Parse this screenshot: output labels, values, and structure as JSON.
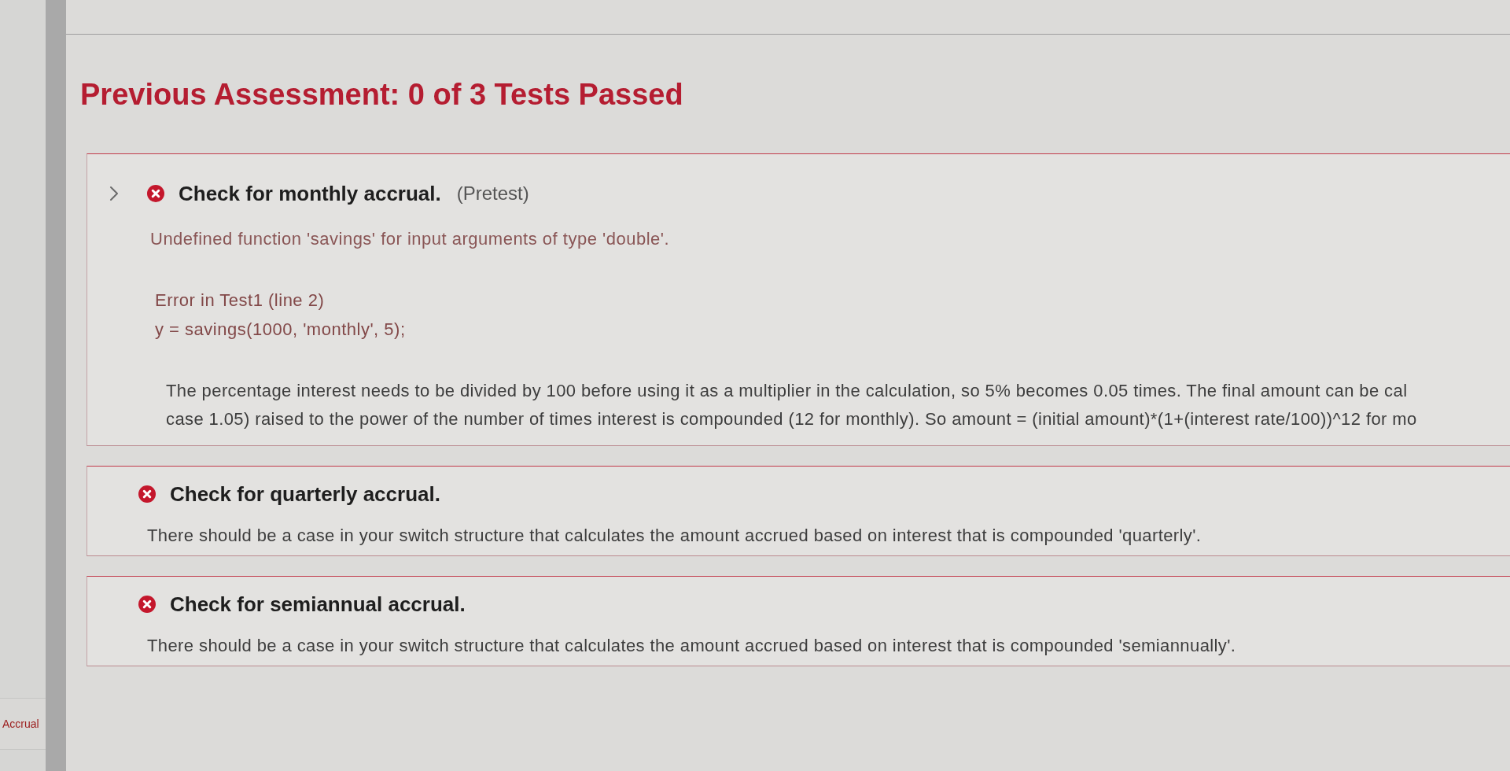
{
  "sidebar": {
    "items": [
      {
        "label": "Accrual",
        "selected": true
      }
    ]
  },
  "heading": "Previous Assessment: 0 of 3 Tests Passed",
  "tests": [
    {
      "title": "Check for monthly accrual.",
      "tag": "(Pretest)",
      "passed": false,
      "expandable": true,
      "error_message": "Undefined function 'savings' for input arguments of type 'double'.",
      "error_location": "Error in Test1 (line 2)",
      "error_code": "y = savings(1000, 'monthly', 5);",
      "feedback_lines": [
        "The percentage interest needs to be divided by 100 before using it as a multiplier in the calculation, so 5% becomes 0.05 times. The final amount can be cal",
        "case 1.05) raised to the power of the number of times interest is compounded (12 for monthly). So amount = (initial amount)*(1+(interest rate/100))^12 for mo"
      ]
    },
    {
      "title": "Check for quarterly accrual.",
      "passed": false,
      "expandable": false,
      "feedback_lines": [
        "There should be a case in your switch structure that calculates the amount accrued based on interest that is compounded 'quarterly'."
      ]
    },
    {
      "title": "Check for semiannual accrual.",
      "passed": false,
      "expandable": false,
      "feedback_lines": [
        "There should be a case in your switch structure that calculates the amount accrued based on interest that is compounded 'semiannually'."
      ]
    }
  ]
}
